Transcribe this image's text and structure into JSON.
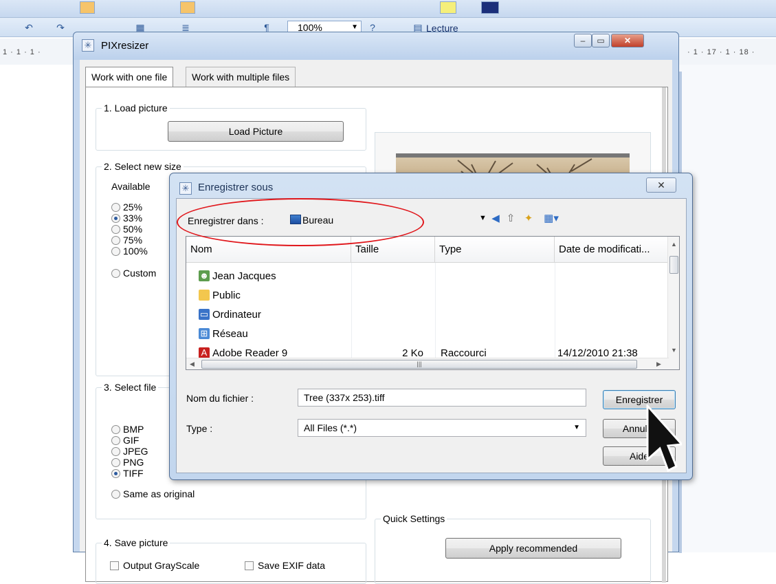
{
  "word": {
    "zoom": "100%",
    "lecture_label": "Lecture",
    "ruler_left": "1 · 1 · 1 ·",
    "ruler_right": "· 1 · 17 · 1 · 18 ·"
  },
  "pixresizer": {
    "title": "PIXresizer",
    "tabs": [
      {
        "label": "Work with one file"
      },
      {
        "label": "Work with multiple files"
      }
    ],
    "groups": {
      "load": {
        "label": "1. Load picture",
        "button": "Load Picture"
      },
      "size": {
        "label": "2. Select new size",
        "available_label": "Available",
        "options": [
          "25%",
          "33%",
          "50%",
          "75%",
          "100%"
        ],
        "selected": "33%",
        "custom_label": "Custom"
      },
      "file_type": {
        "label": "3. Select file",
        "options": [
          "BMP",
          "GIF",
          "JPEG",
          "PNG",
          "TIFF"
        ],
        "selected": "TIFF",
        "same_label": "Same as original"
      },
      "save": {
        "label": "4. Save picture",
        "grayscale": "Output GrayScale",
        "exif": "Save EXIF data"
      },
      "quick": {
        "label": "Quick Settings",
        "button": "Apply recommended"
      }
    }
  },
  "save_dialog": {
    "title": "Enregistrer sous",
    "close_glyph": "✕",
    "save_in_label": "Enregistrer dans :",
    "save_in_value": "Bureau",
    "columns": {
      "name": "Nom",
      "size": "Taille",
      "type": "Type",
      "date": "Date de modificati..."
    },
    "files": [
      {
        "name": "Jean Jacques",
        "size": "",
        "type": "",
        "date": "",
        "icon": "user-folder-icon"
      },
      {
        "name": "Public",
        "size": "",
        "type": "",
        "date": "",
        "icon": "folder-icon"
      },
      {
        "name": "Ordinateur",
        "size": "",
        "type": "",
        "date": "",
        "icon": "computer-icon"
      },
      {
        "name": "Réseau",
        "size": "",
        "type": "",
        "date": "",
        "icon": "network-icon"
      },
      {
        "name": "Adobe Reader 9",
        "size": "2 Ko",
        "type": "Raccourci",
        "date": "14/12/2010 21:38",
        "icon": "adobe-reader-icon"
      }
    ],
    "filename_label": "Nom du fichier :",
    "filename_value": "Tree (337x 253).tiff",
    "type_label": "Type :",
    "type_value": "All Files (*.*)",
    "buttons": {
      "save": "Enregistrer",
      "cancel": "Annuler",
      "help": "Aide"
    }
  },
  "colors": {
    "annotation": "#e0161b",
    "accent": "#2c5a9e"
  }
}
